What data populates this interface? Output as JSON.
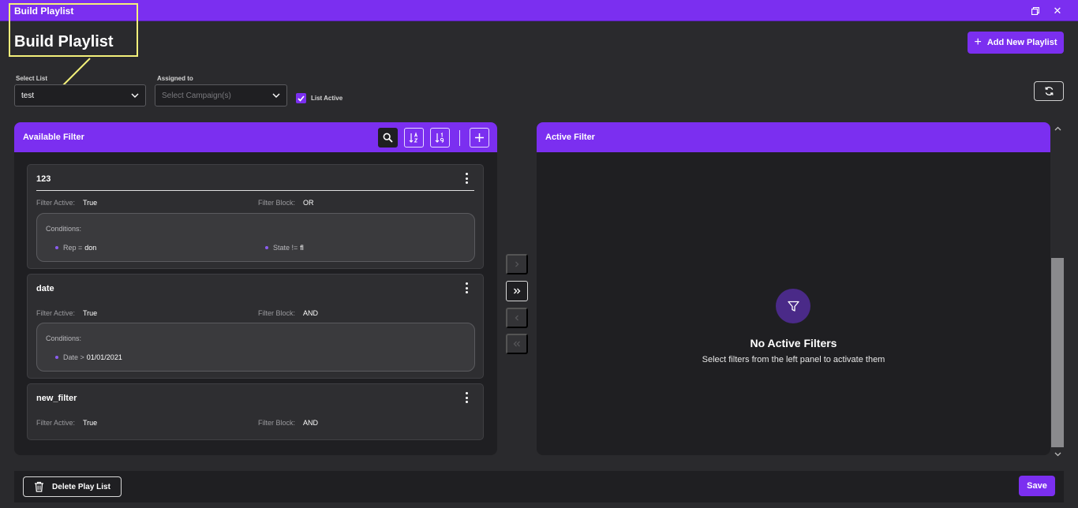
{
  "window": {
    "title": "Build Playlist",
    "restore_icon": "restore-icon",
    "close_glyph": "✕"
  },
  "page": {
    "heading": "Build Playlist",
    "add_button_label": "Add New Playlist"
  },
  "form": {
    "select_list_label": "Select List",
    "select_list_value": "test",
    "assigned_label": "Assigned to",
    "assigned_placeholder": "Select Campaign(s)",
    "list_active_label": "List Active",
    "list_active_checked": true
  },
  "available": {
    "title": "Available Filter",
    "filters": [
      {
        "name": "123",
        "active_label": "Filter Active:",
        "active_value": "True",
        "block_label": "Filter Block:",
        "block_value": "OR",
        "conditions_label": "Conditions:",
        "conditions": [
          {
            "field": "Rep =",
            "value": "don"
          },
          {
            "field": "State !=",
            "value": "fl"
          }
        ]
      },
      {
        "name": "date",
        "active_label": "Filter Active:",
        "active_value": "True",
        "block_label": "Filter Block:",
        "block_value": "AND",
        "conditions_label": "Conditions:",
        "conditions": [
          {
            "field": "Date >",
            "value": "01/01/2021"
          }
        ]
      },
      {
        "name": "new_filter",
        "active_label": "Filter Active:",
        "active_value": "True",
        "block_label": "Filter Block:",
        "block_value": "AND"
      }
    ]
  },
  "active": {
    "title": "Active Filter",
    "empty_title": "No Active Filters",
    "empty_subtitle": "Select filters from the left panel to activate them"
  },
  "footer": {
    "delete_label": "Delete Play List",
    "save_label": "Save"
  },
  "colors": {
    "accent": "#7b2ff0",
    "background": "#2a2a2d",
    "panel": "#1f1f22",
    "annotation": "#f3f07a"
  }
}
